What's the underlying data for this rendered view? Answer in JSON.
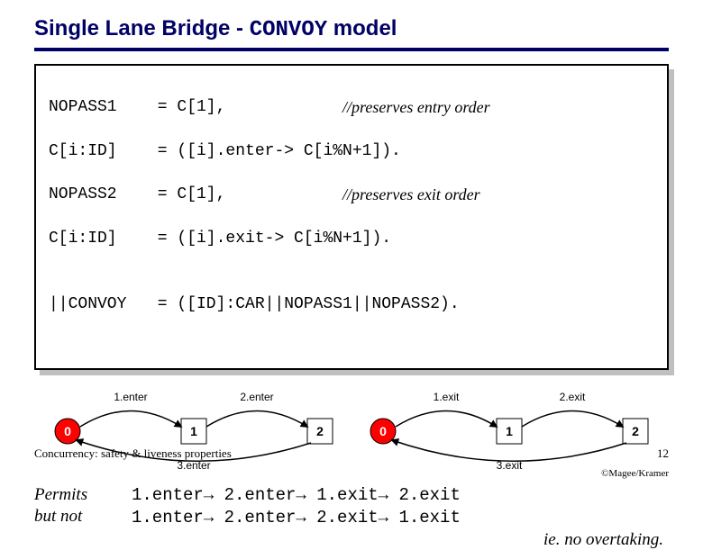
{
  "title": {
    "pre": "Single Lane Bridge - ",
    "mono": "CONVOY",
    "post": " model"
  },
  "code": {
    "l1_lhs": "NOPASS1",
    "l1_rhs_a": " = C[1],            ",
    "l1_cmt": "//preserves entry order",
    "l2_lhs": "C[i:ID]",
    "l2_rhs_a": " = ([i].",
    "l2_kw": "enter",
    "l2_rhs_b": "-> C[i%N+1]).",
    "l3_lhs": "NOPASS2",
    "l3_rhs_a": " = C[1],            ",
    "l3_cmt": "//preserves exit order",
    "l4_lhs": "C[i:ID]",
    "l4_rhs_a": " = ([i].",
    "l4_kw": "exit",
    "l4_rhs_b": "-> C[i%N+1]).",
    "blank": "",
    "l5_lhs": "||CONVOY",
    "l5_rhs": " = ([ID]:CAR||NOPASS1||NOPASS2)."
  },
  "diagrams": {
    "left": {
      "nodes": [
        "0",
        "1",
        "2"
      ],
      "edges": [
        {
          "from": 0,
          "to": 1,
          "label": "1.enter"
        },
        {
          "from": 1,
          "to": 2,
          "label": "2.enter"
        },
        {
          "from": 2,
          "to": 0,
          "label": "3.enter"
        }
      ]
    },
    "right": {
      "nodes": [
        "0",
        "1",
        "2"
      ],
      "edges": [
        {
          "from": 0,
          "to": 1,
          "label": "1.exit"
        },
        {
          "from": 1,
          "to": 2,
          "label": "2.exit"
        },
        {
          "from": 2,
          "to": 0,
          "label": "3.exit"
        }
      ]
    }
  },
  "permits": {
    "label_l1": "Permits",
    "label_l2": "but not",
    "seq_ok": "1.enter→ 2.enter→ 1.exit→ 2.exit",
    "seq_bad": "1.enter→ 2.enter→ 2.exit→ 1.exit",
    "no_overtake": "ie. no overtaking."
  },
  "footer": {
    "left": "Concurrency: safety & liveness properties",
    "right": "12",
    "credit": "©Magee/Kramer"
  }
}
